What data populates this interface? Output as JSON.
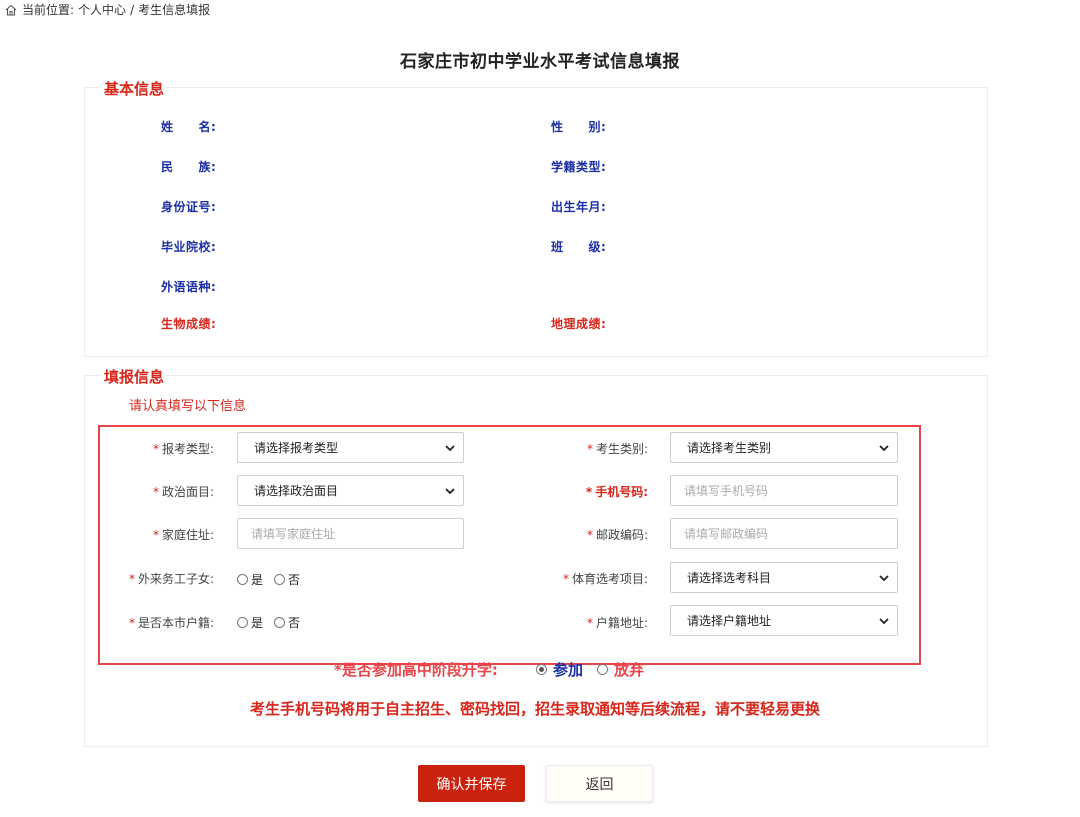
{
  "breadcrumb": {
    "prefix": "当前位置:",
    "item1": "个人中心",
    "separator": "/",
    "item2": "考生信息填报",
    "icon": "home-icon"
  },
  "page_title": "石家庄市初中学业水平考试信息填报",
  "basic_info": {
    "legend": "基本信息",
    "fields": {
      "name": "姓　　名:",
      "gender": "性　　别:",
      "ethnicity": "民　　族:",
      "status_type": "学籍类型:",
      "id_number": "身份证号:",
      "birth_date": "出生年月:",
      "school": "毕业院校:",
      "class": "班　　级:",
      "language": "外语语种:",
      "biology": "生物成绩:",
      "geography": "地理成绩:"
    }
  },
  "fill_info": {
    "legend": "填报信息",
    "hint": "请认真填写以下信息",
    "exam_type": {
      "label": "报考类型:",
      "value": "请选择报考类型"
    },
    "candidate_type": {
      "label": "考生类别:",
      "value": "请选择考生类别"
    },
    "political": {
      "label": "政治面目:",
      "value": "请选择政治面目"
    },
    "phone": {
      "label": "手机号码:",
      "placeholder": "请填写手机号码"
    },
    "address": {
      "label": "家庭住址:",
      "placeholder": "请填写家庭住址"
    },
    "postcode": {
      "label": "邮政编码:",
      "placeholder": "请填写邮政编码"
    },
    "migrant_child": {
      "label": "外来务工子女:",
      "yes": "是",
      "no": "否"
    },
    "pe_item": {
      "label": "体育选考项目:",
      "value": "请选择选考科目"
    },
    "local_hukou": {
      "label": "是否本市户籍:",
      "yes": "是",
      "no": "否"
    },
    "hukou_address": {
      "label": "户籍地址:",
      "value": "请选择户籍地址"
    },
    "star": "*",
    "advance": {
      "label": "*是否参加高中阶段升学:",
      "join": "参加",
      "quit": "放弃",
      "selected": "参加"
    },
    "notice": "考生手机号码将用于自主招生、密码找回，招生录取通知等后续流程，请不要轻易更换"
  },
  "buttons": {
    "confirm": "确认并保存",
    "back": "返回"
  },
  "colors": {
    "accent_red": "#d7261b",
    "label_blue": "#1a2ea6",
    "frame_red": "#e8454a",
    "primary_button": "#c9220e"
  }
}
